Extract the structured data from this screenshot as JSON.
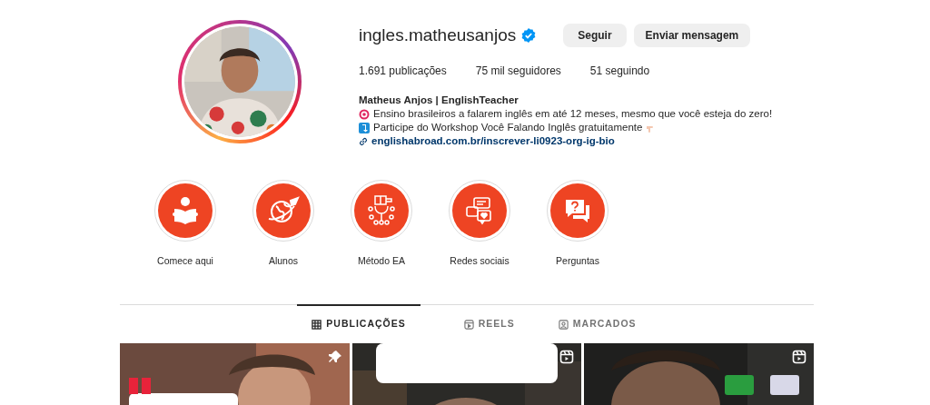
{
  "profile": {
    "username": "ingles.matheusanjos",
    "verified": true,
    "buttons": [
      "Seguir",
      "Enviar mensagem"
    ],
    "stats": [
      "1.691 publicações",
      "75 mil seguidores",
      "51 seguindo"
    ],
    "name": "Matheus Anjos | EnglishTeacher",
    "bio": [
      "Ensino brasileiros a falarem inglês em até 12 meses, mesmo que você esteja do zero!",
      "Participe do Workshop Você Falando Inglês gratuitamente"
    ],
    "link": "englishabroad.com.br/inscrever-li0923-org-ig-bio"
  },
  "highlights": [
    "Comece aqui",
    "Alunos",
    "Método EA",
    "Redes sociais",
    "Perguntas"
  ],
  "tabs": [
    {
      "label": "PUBLICAÇÕES",
      "selected": true
    },
    {
      "label": "REELS",
      "selected": false
    },
    {
      "label": "MARCADOS",
      "selected": false
    }
  ],
  "posts": [
    {
      "kind": "pinned"
    },
    {
      "kind": "reel"
    },
    {
      "kind": "reel"
    }
  ]
}
